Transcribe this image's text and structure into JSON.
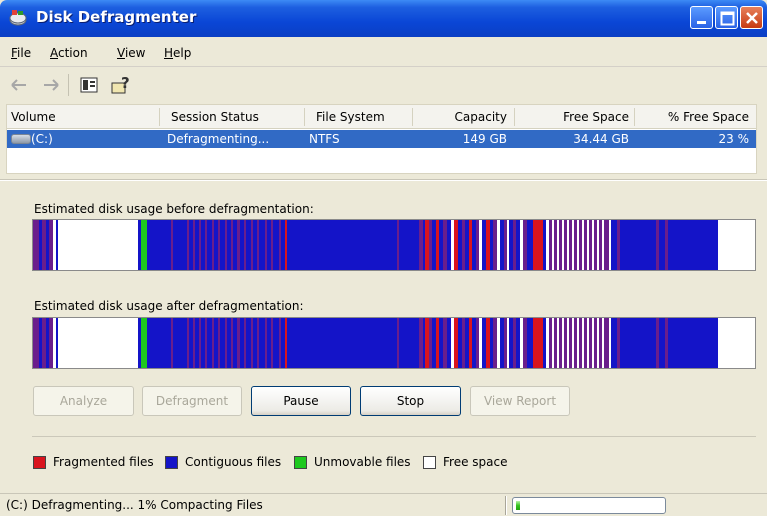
{
  "window": {
    "title": "Disk Defragmenter"
  },
  "menu": {
    "items": [
      {
        "key": "F",
        "rest": "ile"
      },
      {
        "key": "A",
        "rest": "ction"
      },
      {
        "key": "V",
        "rest": "iew"
      },
      {
        "key": "H",
        "rest": "elp"
      }
    ]
  },
  "toolbar": {
    "icons": [
      "back-arrow-icon",
      "forward-arrow-icon",
      "properties-icon",
      "help-icon"
    ]
  },
  "volume_list": {
    "headers": [
      "Volume",
      "Session Status",
      "File System",
      "Capacity",
      "Free Space",
      "% Free Space"
    ],
    "rows": [
      {
        "volume": "(C:)",
        "status": "Defragmenting...",
        "file_system": "NTFS",
        "capacity": "149 GB",
        "free_space": "34.44 GB",
        "percent_free": "23 %"
      }
    ]
  },
  "analysis": {
    "before_label": "Estimated disk usage before defragmentation:",
    "after_label": "Estimated disk usage after defragmentation:"
  },
  "buttons": {
    "analyze": "Analyze",
    "defragment": "Defragment",
    "pause": "Pause",
    "stop": "Stop",
    "view_report": "View Report"
  },
  "legend": [
    {
      "label": "Fragmented files",
      "color": "#d9141e"
    },
    {
      "label": "Contiguous files",
      "color": "#1414c8"
    },
    {
      "label": "Unmovable files",
      "color": "#1ec81e"
    },
    {
      "label": "Free space",
      "color": "#ffffff"
    }
  ],
  "colors": {
    "fragmented": "#d9141e",
    "contiguous": "#1414c8",
    "unmovable": "#1ec81e",
    "free": "#ffffff",
    "purple": "#6a1e8c",
    "selection": "#316ac5"
  },
  "status": {
    "text": "(C:) Defragmenting... 1%  Compacting Files",
    "progress": 0.03
  }
}
